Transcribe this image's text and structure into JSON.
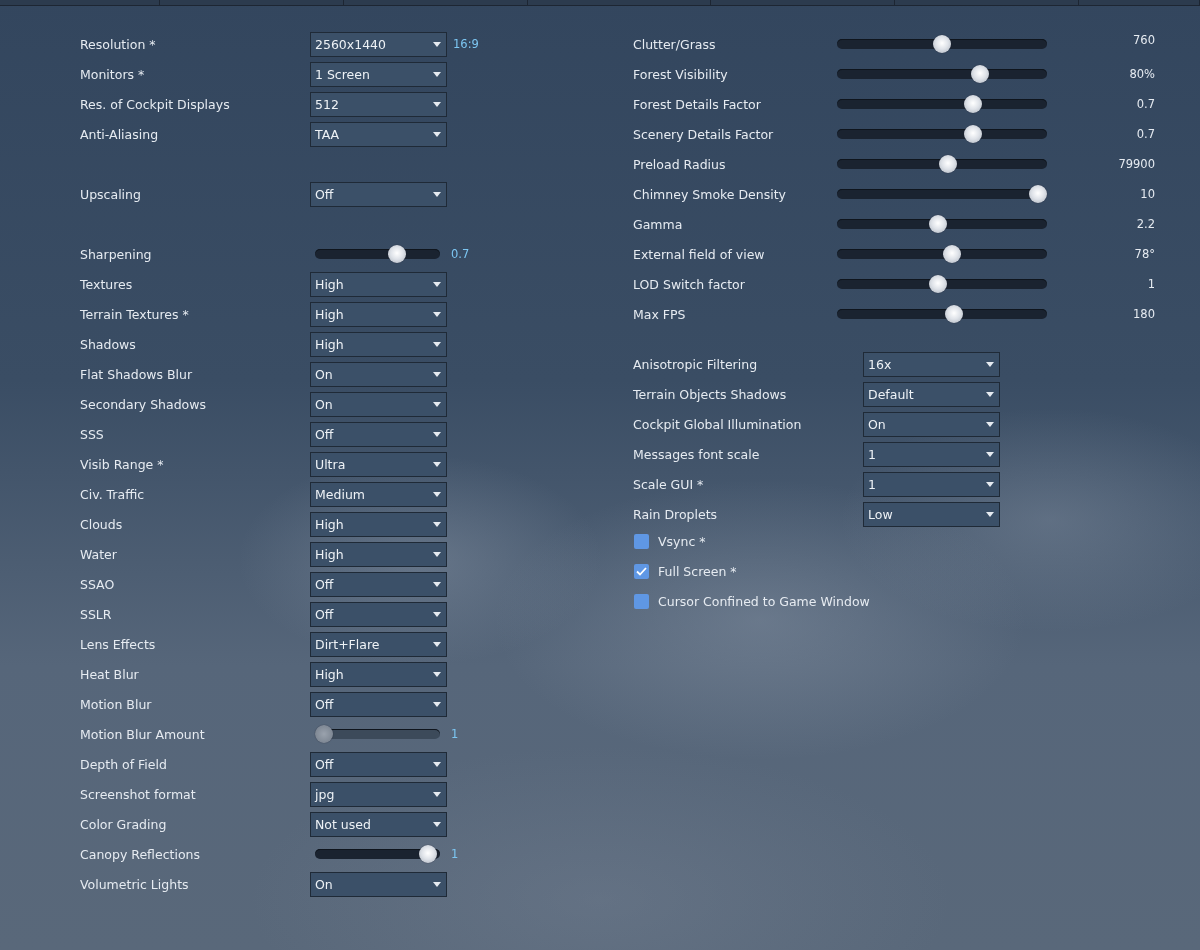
{
  "left": {
    "groups": [
      {
        "rows": [
          {
            "label": "Resolution *",
            "kind": "dropdown",
            "value": "2560x1440",
            "note": "16:9"
          },
          {
            "label": "Monitors *",
            "kind": "dropdown",
            "value": "1 Screen"
          },
          {
            "label": "Res. of Cockpit Displays",
            "kind": "dropdown",
            "value": "512"
          },
          {
            "label": "Anti-Aliasing",
            "kind": "dropdown",
            "value": "TAA"
          }
        ]
      },
      {
        "rows": [
          {
            "label": "Upscaling",
            "kind": "dropdown",
            "value": "Off"
          }
        ]
      },
      {
        "rows": [
          {
            "label": "Sharpening",
            "kind": "slider",
            "level": 0.68,
            "reading": "0.7",
            "disabled": false
          },
          {
            "label": "Textures",
            "kind": "dropdown",
            "value": "High"
          },
          {
            "label": "Terrain Textures *",
            "kind": "dropdown",
            "value": "High"
          },
          {
            "label": "Shadows",
            "kind": "dropdown",
            "value": "High"
          },
          {
            "label": "Flat Shadows Blur",
            "kind": "dropdown",
            "value": "On"
          },
          {
            "label": "Secondary Shadows",
            "kind": "dropdown",
            "value": "On"
          },
          {
            "label": "SSS",
            "kind": "dropdown",
            "value": "Off"
          },
          {
            "label": "Visib Range *",
            "kind": "dropdown",
            "value": "Ultra"
          },
          {
            "label": "Civ. Traffic",
            "kind": "dropdown",
            "value": "Medium"
          },
          {
            "label": "Clouds",
            "kind": "dropdown",
            "value": "High"
          },
          {
            "label": "Water",
            "kind": "dropdown",
            "value": "High"
          },
          {
            "label": "SSAO",
            "kind": "dropdown",
            "value": "Off"
          },
          {
            "label": "SSLR",
            "kind": "dropdown",
            "value": "Off"
          },
          {
            "label": "Lens Effects",
            "kind": "dropdown",
            "value": "Dirt+Flare"
          },
          {
            "label": "Heat Blur",
            "kind": "dropdown",
            "value": "High"
          },
          {
            "label": "Motion Blur",
            "kind": "dropdown",
            "value": "Off"
          },
          {
            "label": "Motion Blur Amount",
            "kind": "slider",
            "level": 0,
            "reading": "1",
            "disabled": true
          },
          {
            "label": "Depth of Field",
            "kind": "dropdown",
            "value": "Off"
          },
          {
            "label": "Screenshot format",
            "kind": "dropdown",
            "value": "jpg"
          },
          {
            "label": "Color Grading",
            "kind": "dropdown",
            "value": "Not used"
          },
          {
            "label": "Canopy Reflections",
            "kind": "slider",
            "level": 0.97,
            "reading": "1",
            "disabled": false
          },
          {
            "label": "Volumetric Lights",
            "kind": "dropdown",
            "value": "On"
          }
        ]
      }
    ]
  },
  "right": {
    "sliders": [
      {
        "label": "Clutter/Grass",
        "level": 0.5,
        "reading": "760"
      },
      {
        "label": "Forest Visibility",
        "level": 0.7,
        "reading": "80%"
      },
      {
        "label": "Forest Details Factor",
        "level": 0.66,
        "reading": "0.7"
      },
      {
        "label": "Scenery Details Factor",
        "level": 0.66,
        "reading": "0.7"
      },
      {
        "label": "Preload Radius",
        "level": 0.53,
        "reading": "79900"
      },
      {
        "label": "Chimney Smoke Density",
        "level": 1,
        "reading": "10"
      },
      {
        "label": "Gamma",
        "level": 0.48,
        "reading": "2.2"
      },
      {
        "label": "External field of view",
        "level": 0.55,
        "reading": "78°"
      },
      {
        "label": "LOD Switch factor",
        "level": 0.48,
        "reading": "1"
      },
      {
        "label": "Max FPS",
        "level": 0.56,
        "reading": "180"
      }
    ],
    "dropdowns": [
      {
        "label": "Anisotropic Filtering",
        "value": "16x"
      },
      {
        "label": "Terrain Objects Shadows",
        "value": "Default"
      },
      {
        "label": "Cockpit Global Illumination",
        "value": "On"
      },
      {
        "label": "Messages font scale",
        "value": "1"
      },
      {
        "label": "Scale GUI *",
        "value": "1"
      },
      {
        "label": "Rain Droplets",
        "value": "Low"
      }
    ],
    "checkboxes": [
      {
        "label": "Vsync *",
        "checked": false
      },
      {
        "label": "Full Screen *",
        "checked": true
      },
      {
        "label": "Cursor Confined to Game Window",
        "checked": false
      }
    ]
  }
}
